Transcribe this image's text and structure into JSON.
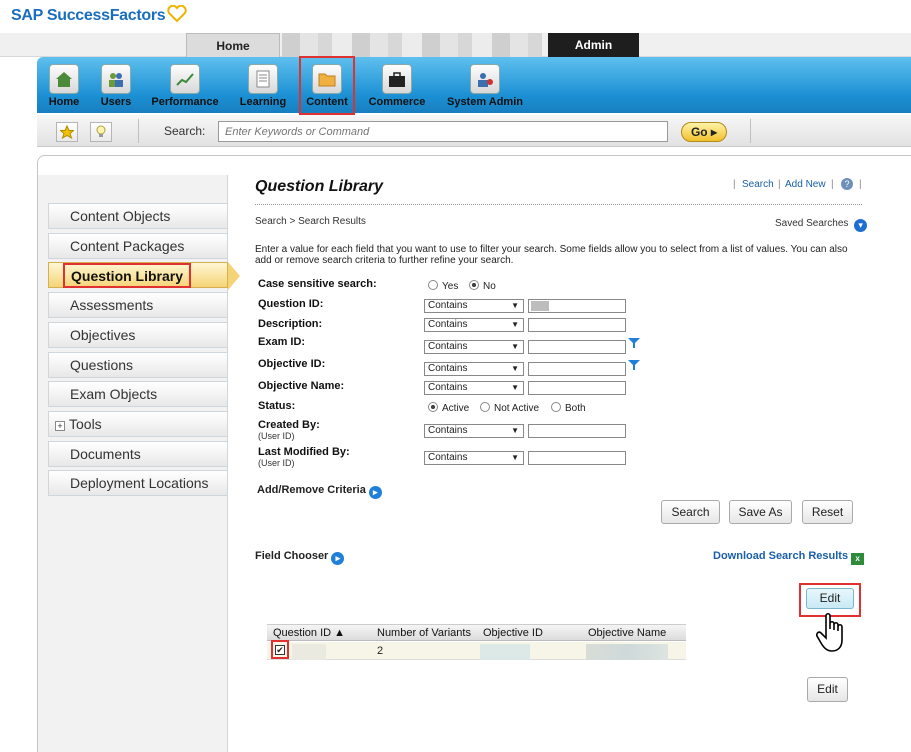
{
  "brand": {
    "name": "SAP SuccessFactors"
  },
  "topnav": {
    "home": "Home",
    "admin": "Admin"
  },
  "toolbar": {
    "items": [
      {
        "label": "Home"
      },
      {
        "label": "Users"
      },
      {
        "label": "Performance"
      },
      {
        "label": "Learning"
      },
      {
        "label": "Content"
      },
      {
        "label": "Commerce"
      },
      {
        "label": "System Admin"
      }
    ]
  },
  "searchbar": {
    "label": "Search:",
    "placeholder": "Enter Keywords or Command",
    "go": "Go"
  },
  "sidebar": {
    "items": [
      {
        "label": "Content Objects"
      },
      {
        "label": "Content Packages"
      },
      {
        "label": "Question Library"
      },
      {
        "label": "Assessments"
      },
      {
        "label": "Objectives"
      },
      {
        "label": "Questions"
      },
      {
        "label": "Exam Objects"
      },
      {
        "label": "Tools"
      },
      {
        "label": "Documents"
      },
      {
        "label": "Deployment Locations"
      }
    ]
  },
  "main": {
    "title": "Question Library",
    "links": {
      "search": "Search",
      "add_new": "Add New"
    },
    "breadcrumb": "Search > Search Results",
    "saved_searches": "Saved Searches",
    "intro": "Enter a value for each field that you want to use to filter your search. Some fields allow you to select from a list of values. You can also add or remove search criteria to further refine your search.",
    "case_sensitive": {
      "label": "Case sensitive search:",
      "yes": "Yes",
      "no": "No"
    },
    "fields": {
      "question_id": {
        "label": "Question ID:",
        "op": "Contains"
      },
      "description": {
        "label": "Description:",
        "op": "Contains"
      },
      "exam_id": {
        "label": "Exam ID:",
        "op": "Contains"
      },
      "objective_id": {
        "label": "Objective ID:",
        "op": "Contains"
      },
      "objective_name": {
        "label": "Objective Name:",
        "op": "Contains"
      },
      "status": {
        "label": "Status:",
        "active": "Active",
        "not_active": "Not Active",
        "both": "Both"
      },
      "created_by": {
        "label": "Created By:",
        "sub": "(User ID)",
        "op": "Contains"
      },
      "last_modified_by": {
        "label": "Last Modified By:",
        "sub": "(User ID)",
        "op": "Contains"
      }
    },
    "add_remove": "Add/Remove Criteria",
    "buttons": {
      "search": "Search",
      "save_as": "Save As",
      "reset": "Reset",
      "edit": "Edit"
    },
    "field_chooser": "Field Chooser",
    "download": "Download Search Results",
    "table": {
      "headers": [
        "Question ID ▲",
        "Number of Variants",
        "Objective ID",
        "Objective Name"
      ],
      "rows": [
        {
          "variants": "2"
        }
      ]
    }
  }
}
